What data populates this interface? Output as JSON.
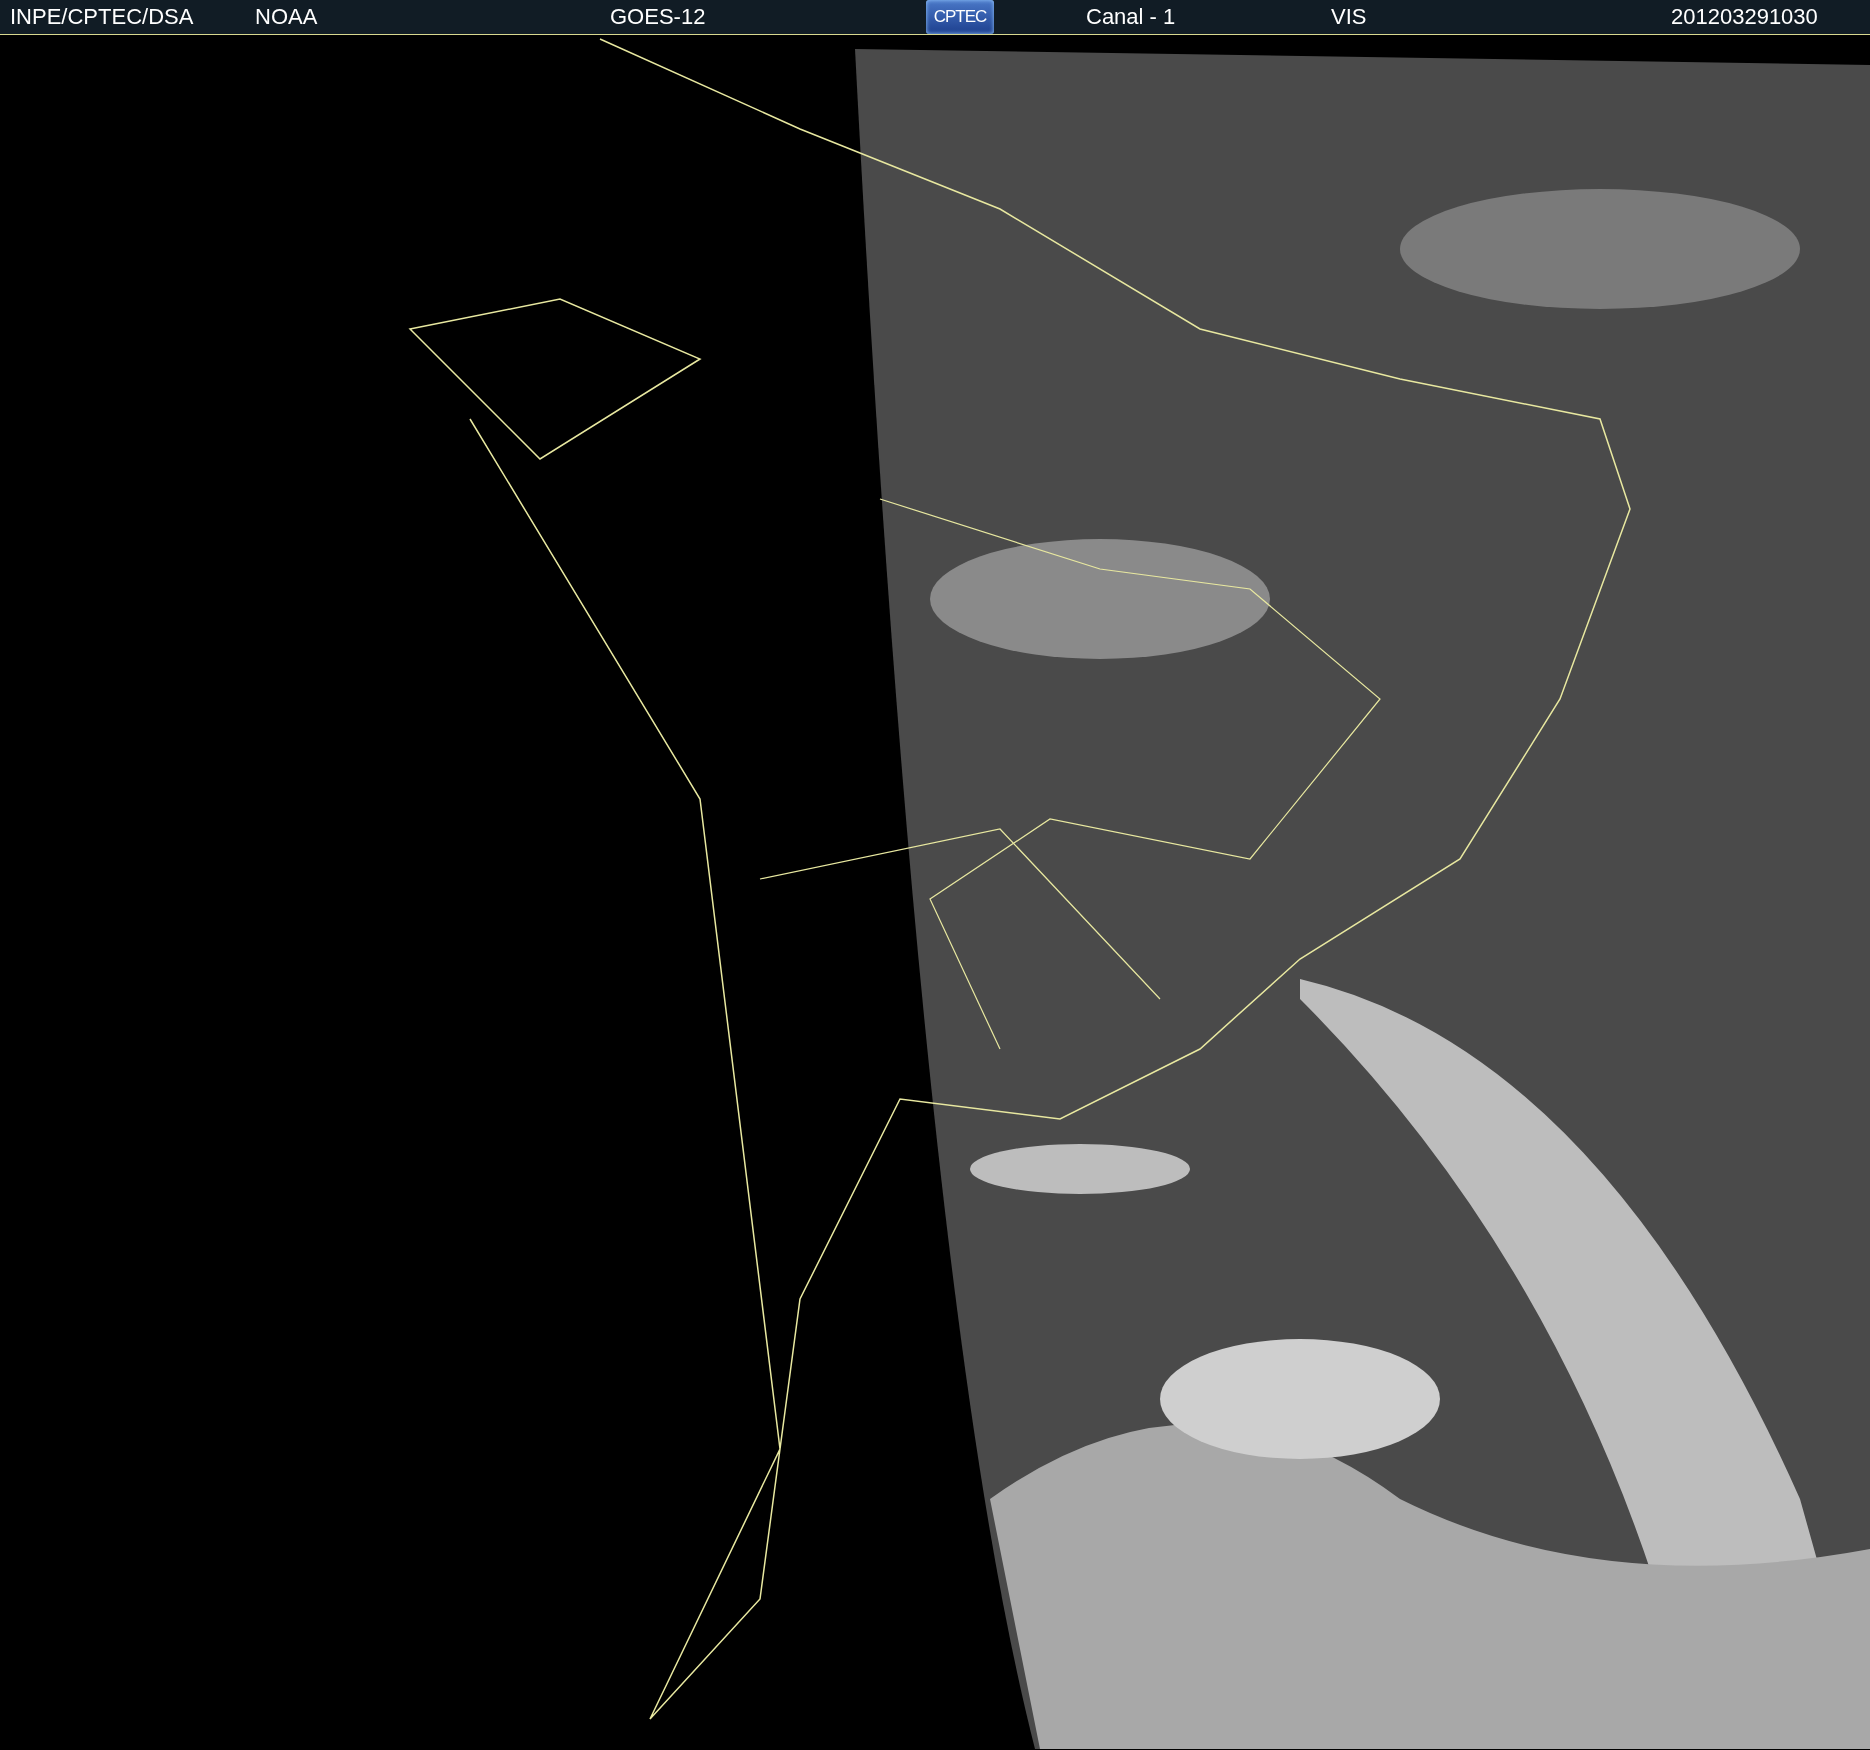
{
  "header": {
    "items": [
      {
        "kind": "text",
        "text": "INPE/CPTEC/DSA"
      },
      {
        "kind": "text",
        "text": "NOAA"
      },
      {
        "kind": "text",
        "text": "GOES-12"
      },
      {
        "kind": "logo",
        "text": "CPTEC"
      },
      {
        "kind": "text",
        "text": "Canal - 1"
      },
      {
        "kind": "text",
        "text": "VIS"
      },
      {
        "kind": "text",
        "text": "201203291030"
      }
    ]
  }
}
